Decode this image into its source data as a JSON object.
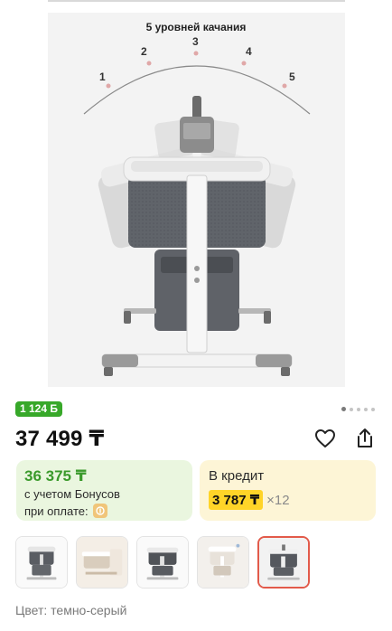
{
  "gallery": {
    "image_caption": "5 уровней качания",
    "levels": [
      "1",
      "2",
      "3",
      "4",
      "5"
    ],
    "image_count": 5,
    "active_index": 0
  },
  "bonus_badge": "1 124 Б",
  "price": "37 499 ₸",
  "icons": {
    "favorite": "heart-icon",
    "share": "share-icon",
    "bonus_coin": "coin-icon"
  },
  "bonus_offer": {
    "price": "36 375 ₸",
    "line1": "с учетом Бонусов",
    "line2": "при оплате:"
  },
  "credit_offer": {
    "title": "В кредит",
    "monthly": "3 787 ₸",
    "multiplier": "×12"
  },
  "thumbnails": [
    {
      "label": "variant-1",
      "selected": false
    },
    {
      "label": "variant-2",
      "selected": false
    },
    {
      "label": "variant-3",
      "selected": false
    },
    {
      "label": "variant-4",
      "selected": false
    },
    {
      "label": "variant-5",
      "selected": true
    }
  ],
  "color_text": "Цвет: темно-серый",
  "colors": {
    "bonus_green": "#37a829",
    "price_green": "#3a9a2b",
    "credit_yellow": "#ffd428",
    "selected_border": "#e25a4a"
  }
}
